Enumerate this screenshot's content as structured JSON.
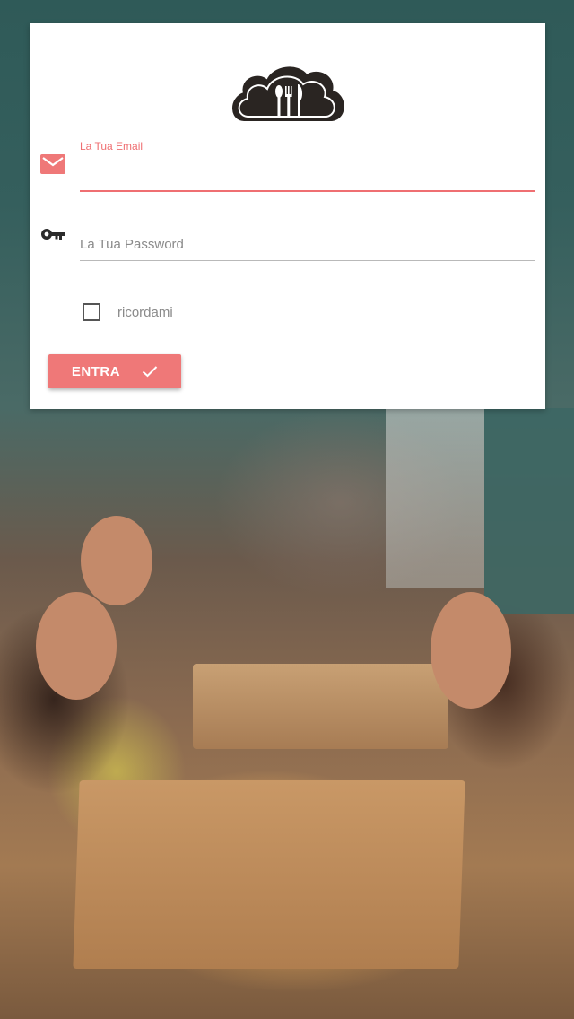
{
  "login_form": {
    "email_label": "La Tua Email",
    "email_value": "",
    "password_placeholder": "La Tua Password",
    "remember_label": "ricordami",
    "remember_checked": false,
    "submit_label": "ENTRA"
  },
  "icons": {
    "logo": "cloud-cutlery-logo",
    "email": "mail-icon",
    "password": "key-icon",
    "submit": "check-icon"
  },
  "colors": {
    "accent": "#ef7878",
    "label_accent": "#ef6f72",
    "card": "#ffffff",
    "logo": "#2a2522"
  }
}
